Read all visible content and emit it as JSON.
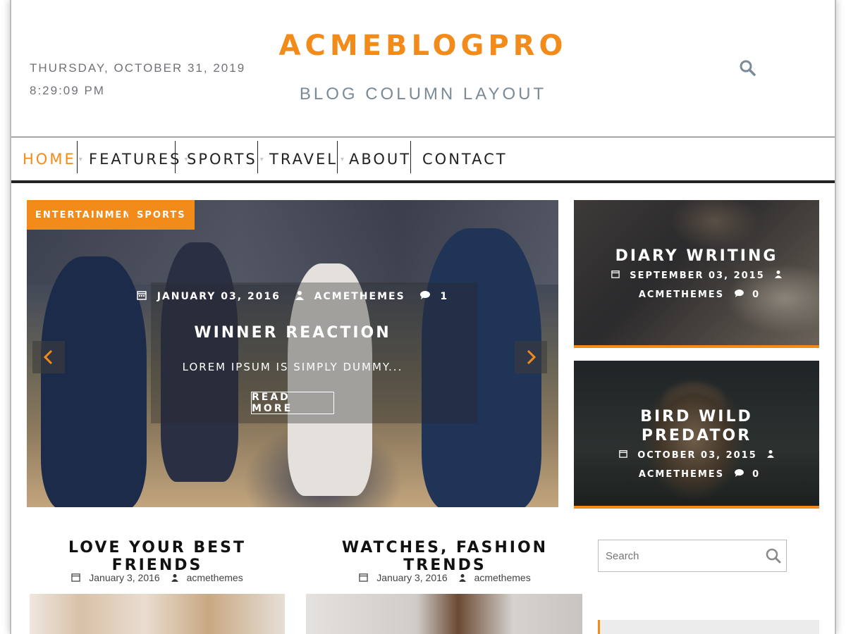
{
  "header": {
    "date": "THURSDAY, OCTOBER 31, 2019",
    "time": "8:29:09 PM",
    "site_title": "ACMEBLOGPRO",
    "site_description": "BLOG COLUMN LAYOUT"
  },
  "nav": {
    "items": [
      {
        "label": "HOME",
        "has_submenu": true,
        "active": true
      },
      {
        "label": "FEATURES",
        "has_submenu": true,
        "active": false
      },
      {
        "label": "SPORTS",
        "has_submenu": true,
        "active": false
      },
      {
        "label": "TRAVEL",
        "has_submenu": true,
        "active": false
      },
      {
        "label": "ABOUT",
        "has_submenu": false,
        "active": false
      },
      {
        "label": "CONTACT",
        "has_submenu": false,
        "active": false
      }
    ]
  },
  "slider": {
    "categories": [
      "ENTERTAINMENT",
      "SPORTS"
    ],
    "date": "JANUARY 03, 2016",
    "author": "ACMETHEMES",
    "comments": "1",
    "title": "WINNER REACTION",
    "excerpt": "LOREM IPSUM IS SIMPLY DUMMY...",
    "read_more": "READ MORE"
  },
  "side_posts": [
    {
      "title": "DIARY WRITING",
      "date": "SEPTEMBER 03, 2015",
      "author": "ACMETHEMES",
      "comments": "0"
    },
    {
      "title_line1": "BIRD WILD",
      "title_line2": "PREDATOR",
      "date": "OCTOBER 03, 2015",
      "author": "ACMETHEMES",
      "comments": "0"
    }
  ],
  "posts": [
    {
      "title": "LOVE YOUR BEST FRIENDS",
      "date": "January 3, 2016",
      "author": "acmethemes"
    },
    {
      "title": "WATCHES, FASHION TRENDS",
      "date": "January 3, 2016",
      "author": "acmethemes"
    }
  ],
  "sidebar": {
    "search_placeholder": "Search"
  },
  "colors": {
    "accent": "#f28b1a",
    "text_dark": "#222222",
    "text_muted": "#7b8a97"
  }
}
